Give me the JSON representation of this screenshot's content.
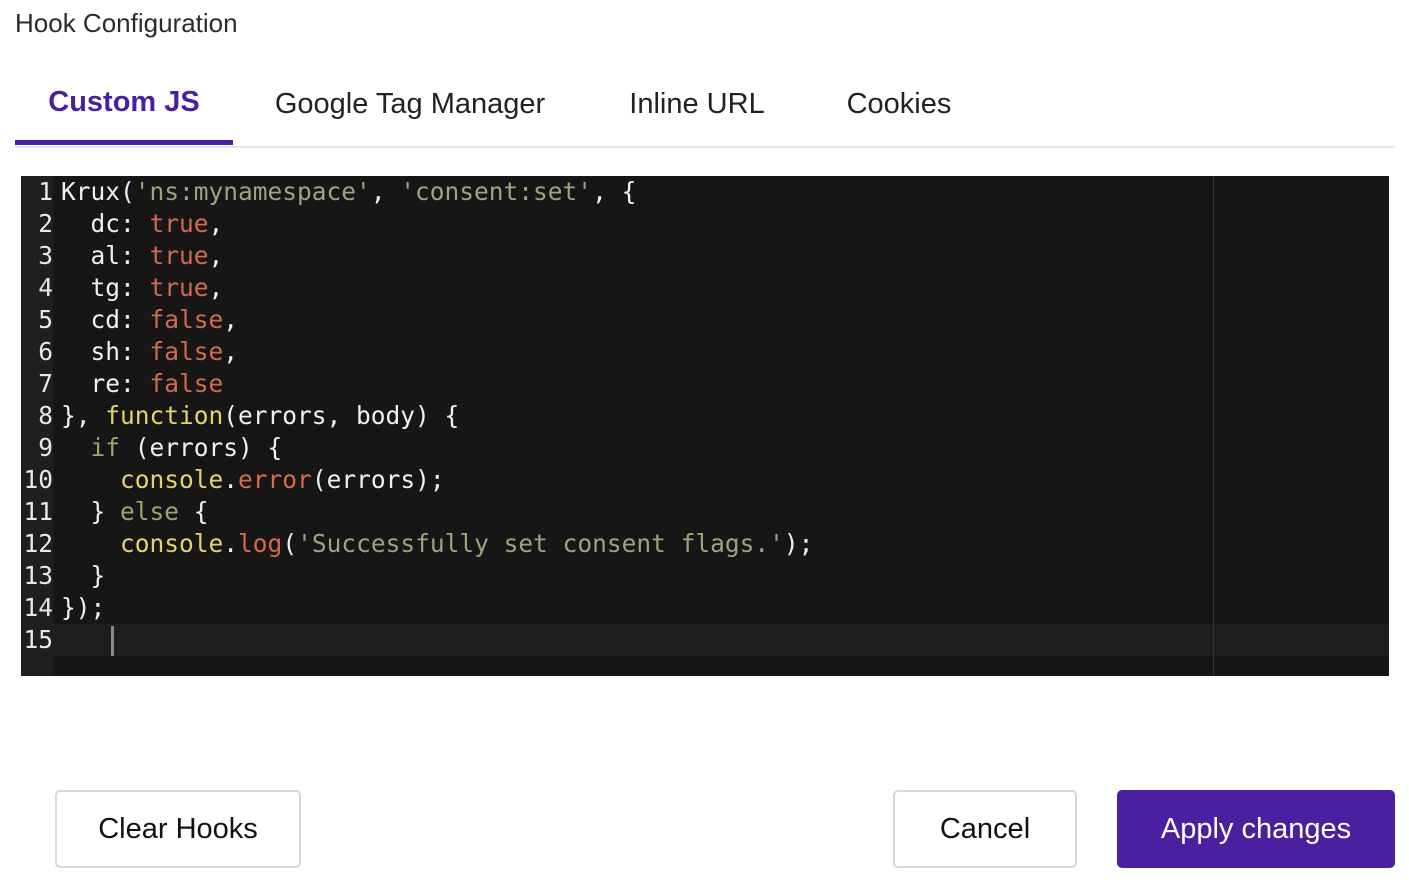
{
  "dialog": {
    "title": "Hook Configuration"
  },
  "tabs": [
    {
      "label": "Custom JS",
      "active": true
    },
    {
      "label": "Google Tag Manager",
      "active": false
    },
    {
      "label": "Inline URL",
      "active": false
    },
    {
      "label": "Cookies",
      "active": false
    }
  ],
  "editor": {
    "language": "javascript",
    "cursor_line": 15,
    "line_numbers": [
      "1",
      "2",
      "3",
      "4",
      "5",
      "6",
      "7",
      "8",
      "9",
      "10",
      "11",
      "12",
      "13",
      "14",
      "15"
    ],
    "lines": [
      "Krux('ns:mynamespace', 'consent:set', {",
      "  dc: true,",
      "  al: true,",
      "  tg: true,",
      "  cd: false,",
      "  sh: false,",
      "  re: false",
      "}, function(errors, body) {",
      "  if (errors) {",
      "    console.error(errors);",
      "  } else {",
      "    console.log('Successfully set consent flags.');",
      "  }",
      "});",
      ""
    ]
  },
  "buttons": {
    "clear": "Clear Hooks",
    "cancel": "Cancel",
    "apply": "Apply changes"
  },
  "colors": {
    "accent": "#4a1fa0",
    "editor_bg": "#161616",
    "string": "#9aa57a",
    "boolean": "#d46a4a",
    "function": "#e6d26c"
  }
}
